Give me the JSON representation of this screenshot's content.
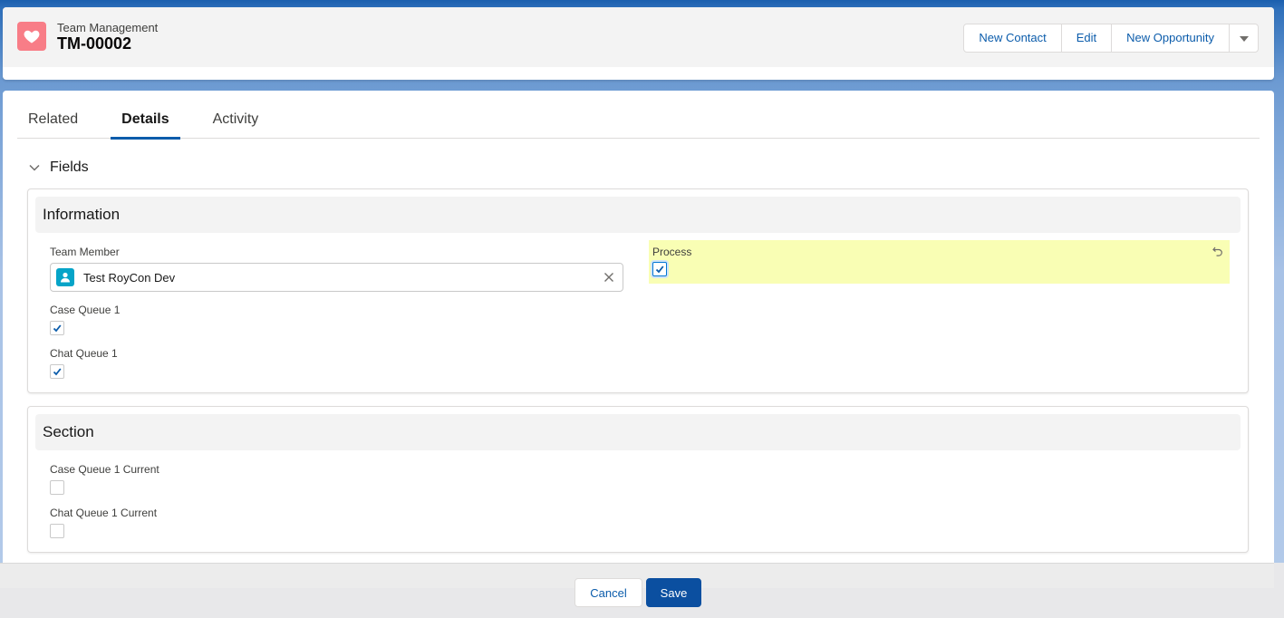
{
  "header": {
    "record_type": "Team Management",
    "record_name": "TM-00002",
    "icon": "heart-icon",
    "icon_color": "#f87d87",
    "actions": [
      "New Contact",
      "Edit",
      "New Opportunity"
    ],
    "more_actions_icon": "caret-down-icon"
  },
  "tabs": [
    {
      "label": "Related",
      "active": false
    },
    {
      "label": "Details",
      "active": true
    },
    {
      "label": "Activity",
      "active": false
    }
  ],
  "fields_section": {
    "label": "Fields",
    "expanded": true
  },
  "information": {
    "title": "Information",
    "team_member": {
      "label": "Team Member",
      "value": "Test RoyCon Dev",
      "icon": "contact-icon"
    },
    "process": {
      "label": "Process",
      "checked": true,
      "edited": true
    },
    "case_queue_1": {
      "label": "Case Queue 1",
      "checked": true
    },
    "chat_queue_1": {
      "label": "Chat Queue 1",
      "checked": true
    }
  },
  "section": {
    "title": "Section",
    "case_queue_1_current": {
      "label": "Case Queue 1 Current",
      "checked": false
    },
    "chat_queue_1_current": {
      "label": "Chat Queue 1 Current",
      "checked": false
    }
  },
  "footer": {
    "cancel_label": "Cancel",
    "save_label": "Save"
  },
  "colors": {
    "brand_blue": "#0b5cab",
    "save_button": "#0b4fa0",
    "edited_highlight": "#f9feb4",
    "contact_icon": "#06a4c8"
  }
}
